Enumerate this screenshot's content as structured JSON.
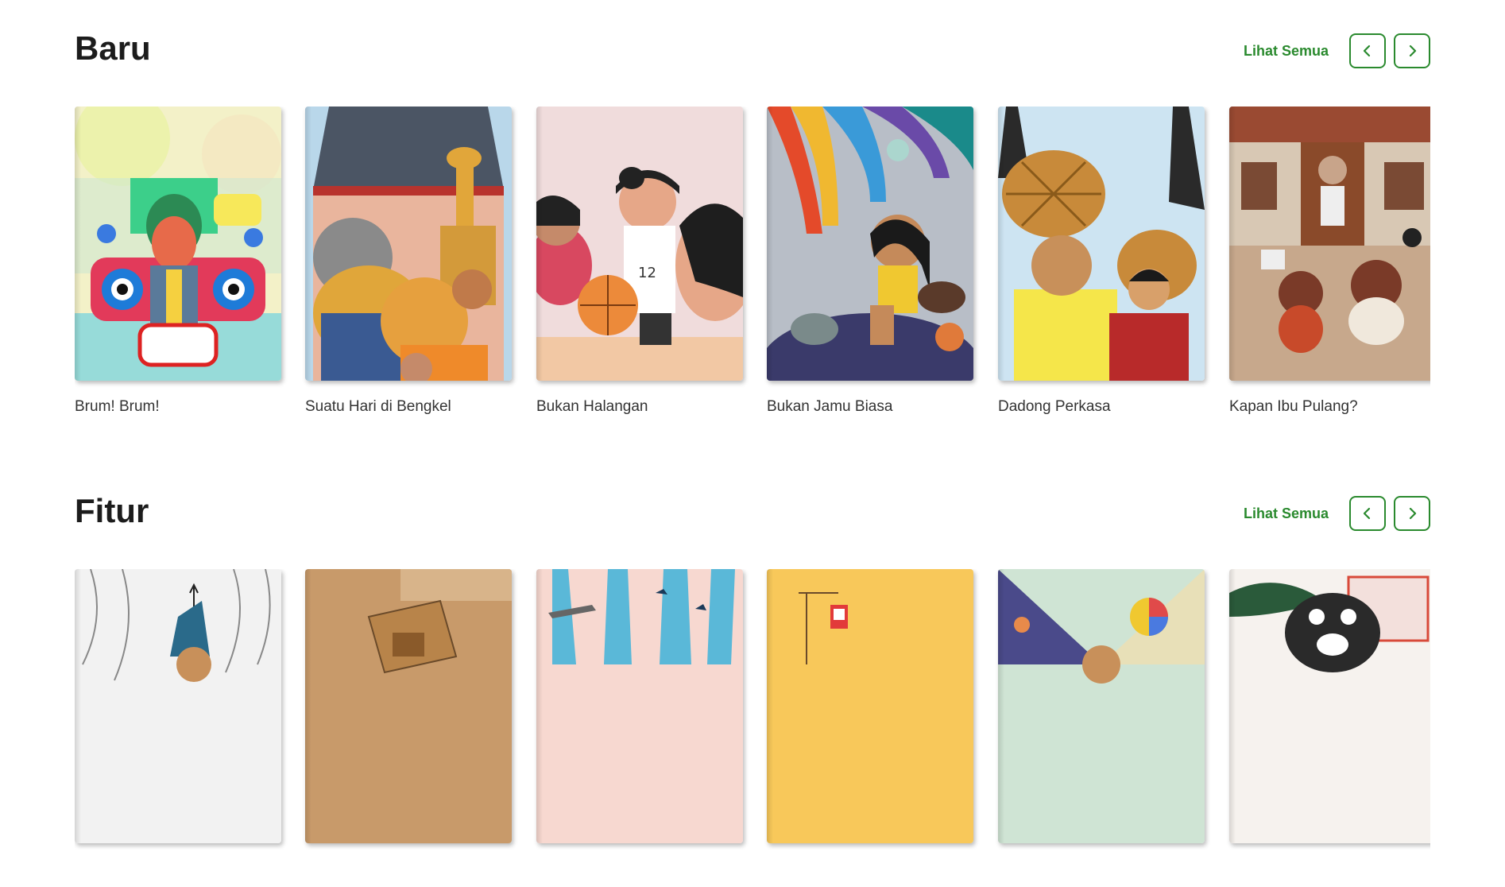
{
  "sections": {
    "baru": {
      "title": "Baru",
      "see_all": "Lihat Semua",
      "books": [
        {
          "title": "Brum! Brum!"
        },
        {
          "title": "Suatu Hari di Bengkel"
        },
        {
          "title": "Bukan Halangan"
        },
        {
          "title": "Bukan Jamu Biasa"
        },
        {
          "title": "Dadong Perkasa"
        },
        {
          "title": "Kapan Ibu Pulang?"
        }
      ]
    },
    "fitur": {
      "title": "Fitur",
      "see_all": "Lihat Semua"
    }
  },
  "cover_texts": {
    "jersey_number": "12"
  },
  "icons": {
    "prev": "chevron-left-icon",
    "next": "chevron-right-icon"
  },
  "colors": {
    "accent": "#2a8a2e",
    "text": "#1c1c1c"
  }
}
